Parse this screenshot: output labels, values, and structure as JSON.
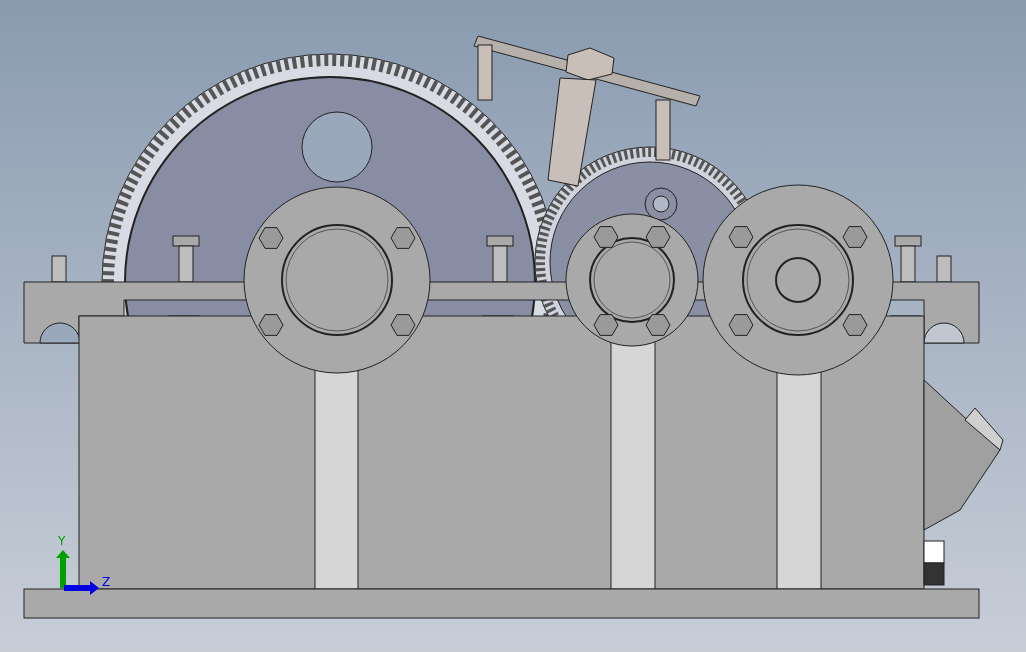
{
  "viewport": {
    "triad": {
      "axes": [
        {
          "kind": "vertical",
          "label": "Y",
          "color": "#00a000"
        },
        {
          "kind": "horizontal",
          "label": "Z",
          "color": "#0000e0"
        }
      ]
    }
  }
}
